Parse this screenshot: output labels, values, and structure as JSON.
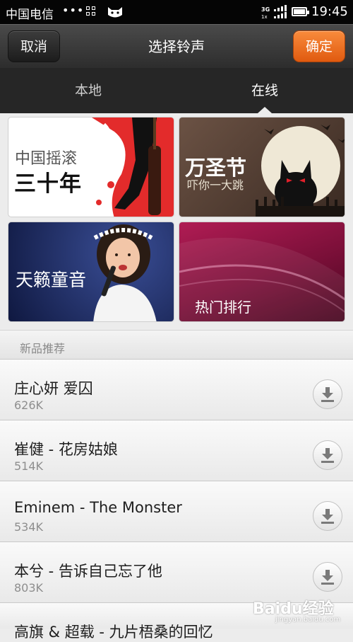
{
  "status_bar": {
    "carrier": "中国电信",
    "dots": "•••",
    "network": "3G",
    "time": "19:45"
  },
  "header": {
    "cancel_label": "取消",
    "title": "选择铃声",
    "confirm_label": "确定",
    "confirm_color": "#ef7226"
  },
  "tabs": [
    {
      "label": "本地",
      "selected": false
    },
    {
      "label": "在线",
      "selected": true
    }
  ],
  "banners": [
    {
      "line1": "中国摇滚",
      "line2": "三十年"
    },
    {
      "line1": "万圣节",
      "line2": "吓你一大跳"
    },
    {
      "line1": "天籁童音"
    },
    {
      "line1": "热门排行"
    }
  ],
  "section": {
    "label": "新品推荐"
  },
  "songs": [
    {
      "title": "庄心妍 爱囚",
      "size": "626K"
    },
    {
      "title": "崔健 - 花房姑娘",
      "size": "514K"
    },
    {
      "title": "Eminem - The Monster",
      "size": "534K"
    },
    {
      "title": "本兮 - 告诉自己忘了他",
      "size": "803K"
    },
    {
      "title": "高旗 & 超载 - 九片梧桑的回忆",
      "size": ""
    }
  ],
  "watermark": {
    "text": "Baidu经验",
    "sub": "jingyan.baidu.com"
  }
}
